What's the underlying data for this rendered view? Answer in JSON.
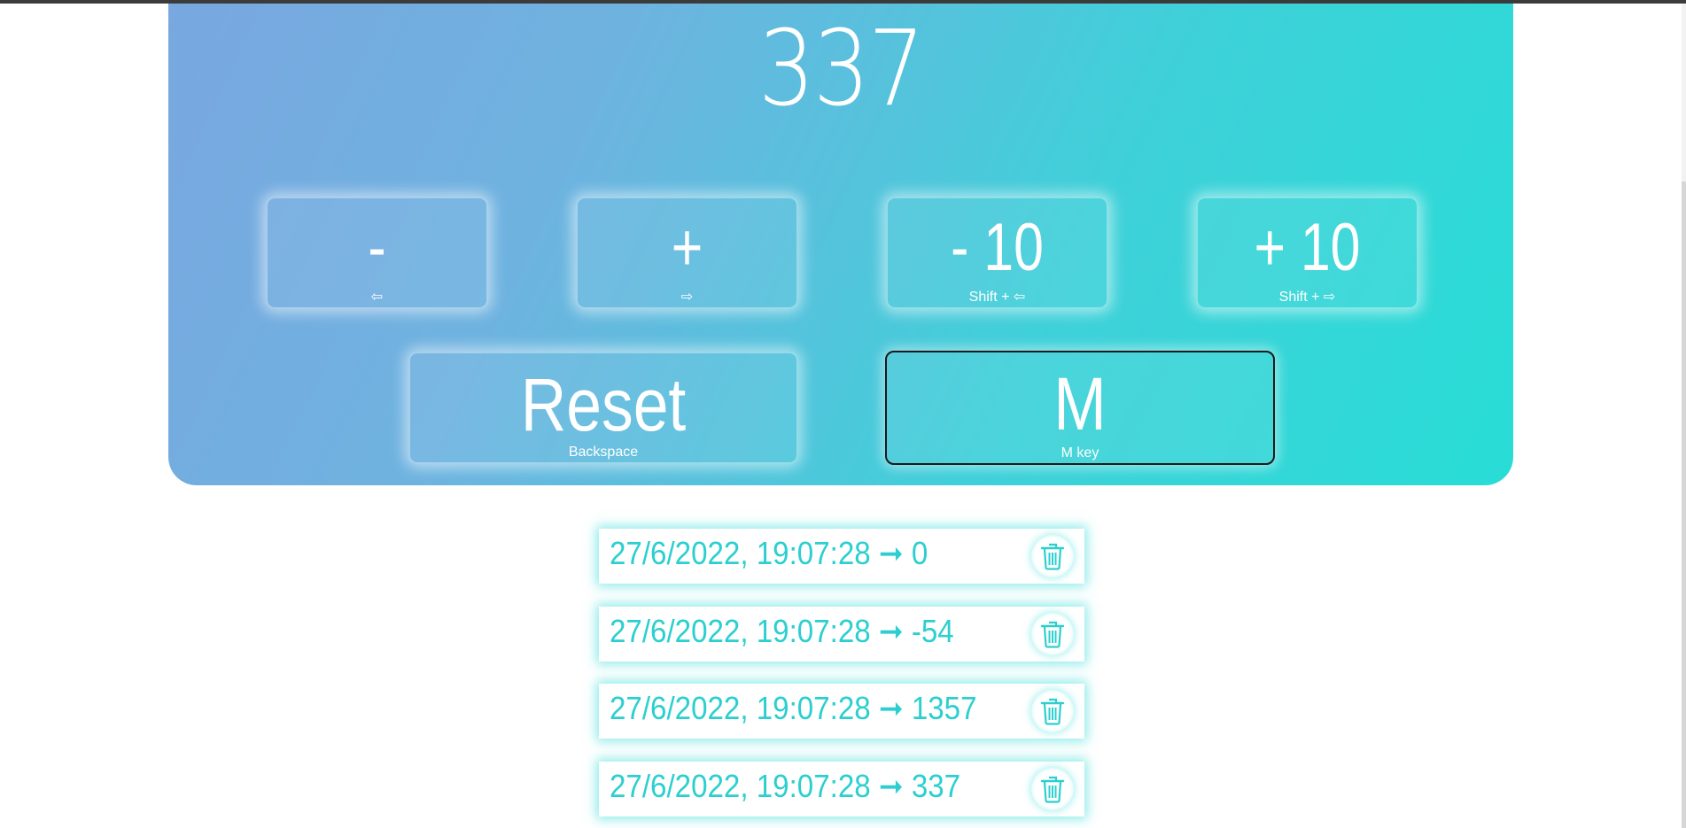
{
  "counter": {
    "value": "337"
  },
  "buttons": {
    "minus": {
      "label": "-",
      "hint": "⇦"
    },
    "plus": {
      "label": "+",
      "hint": "⇨"
    },
    "minus10": {
      "label": "- 10",
      "hint": "Shift + ⇦"
    },
    "plus10": {
      "label": "+ 10",
      "hint": "Shift + ⇨"
    },
    "reset": {
      "label": "Reset",
      "hint": "Backspace"
    },
    "memory": {
      "label": "M",
      "hint": "M key"
    }
  },
  "history": [
    {
      "text": "27/6/2022, 19:07:28 ➞ 0"
    },
    {
      "text": "27/6/2022, 19:07:28 ➞ -54"
    },
    {
      "text": "27/6/2022, 19:07:28 ➞ 1357"
    },
    {
      "text": "27/6/2022, 19:07:28 ➞ 337"
    }
  ],
  "colors": {
    "gradient_start": "#79a7e0",
    "gradient_end": "#28ddd6",
    "accent": "#2ccfd0"
  },
  "icons": {
    "delete": "trash-icon"
  }
}
